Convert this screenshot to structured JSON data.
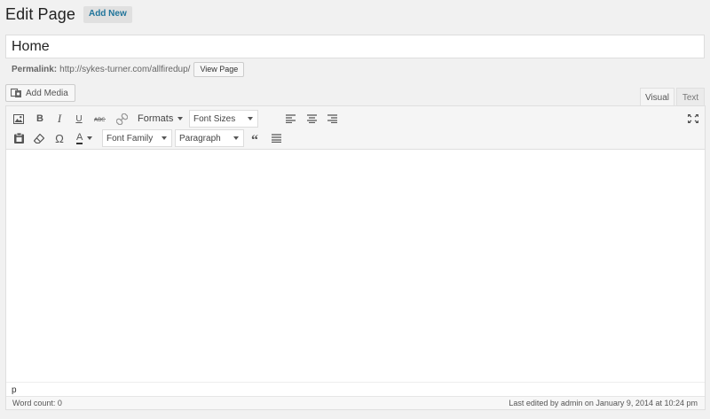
{
  "header": {
    "title": "Edit Page",
    "add_new_label": "Add New"
  },
  "post": {
    "title_value": "Home"
  },
  "permalink": {
    "label": "Permalink:",
    "url": "http://sykes-turner.com/allfiredup/",
    "view_page_label": "View Page"
  },
  "media": {
    "add_media_label": "Add Media"
  },
  "tabs": {
    "visual": "Visual",
    "text": "Text"
  },
  "toolbar": {
    "formats_label": "Formats",
    "font_sizes_label": "Font Sizes",
    "font_family_label": "Font Family",
    "paragraph_label": "Paragraph",
    "bold_label": "B",
    "italic_label": "I",
    "underline_label": "U",
    "omega_label": "Ω",
    "text_color_label": "A",
    "quote_label": "“"
  },
  "editor": {
    "path": "p"
  },
  "status": {
    "word_count": "Word count: 0",
    "last_edited": "Last edited by admin on January 9, 2014 at 10:24 pm"
  },
  "icons": {
    "image": "image-icon",
    "bold": "bold-icon",
    "italic": "italic-icon",
    "underline": "underline-icon",
    "strikethrough": "strikethrough-icon",
    "link": "link-icon",
    "align_left": "align-left-icon",
    "align_center": "align-center-icon",
    "align_right": "align-right-icon",
    "fullscreen": "fullscreen-icon",
    "paste": "paste-as-text-icon",
    "eraser": "clear-formatting-icon",
    "omega": "special-character-icon",
    "text_color": "text-color-icon",
    "blockquote": "blockquote-icon",
    "justify": "align-justify-icon",
    "media": "add-media-icon"
  }
}
